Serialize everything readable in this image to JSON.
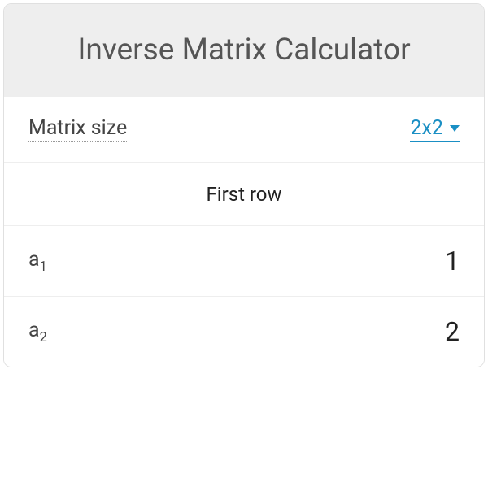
{
  "title": "Inverse Matrix Calculator",
  "matrixSize": {
    "label": "Matrix size",
    "value": "2x2"
  },
  "section": {
    "title": "First row"
  },
  "rows": [
    {
      "label": "a",
      "subscript": "1",
      "value": "1"
    },
    {
      "label": "a",
      "subscript": "2",
      "value": "2"
    }
  ]
}
